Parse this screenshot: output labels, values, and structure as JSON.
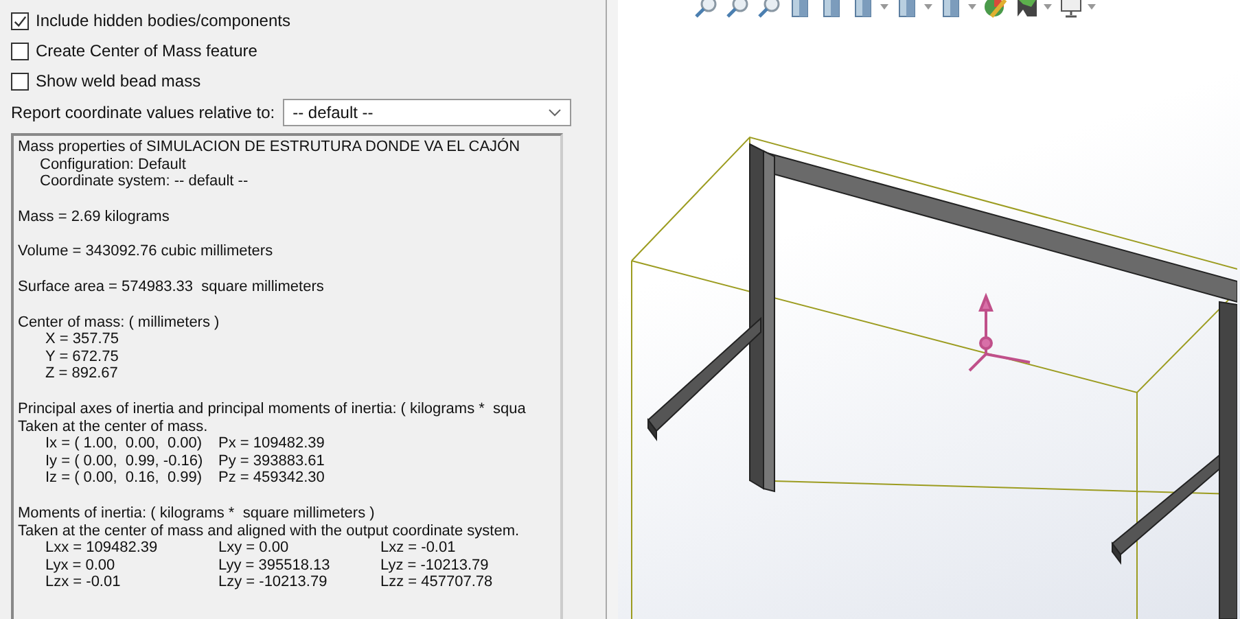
{
  "options": [
    {
      "label": "Include hidden bodies/components",
      "checked": true
    },
    {
      "label": "Create Center of Mass feature",
      "checked": false
    },
    {
      "label": "Show weld bead mass",
      "checked": false
    }
  ],
  "coordinate": {
    "label": "Report coordinate values relative to:",
    "value": "-- default --"
  },
  "results": [
    {
      "lines": [
        {
          "text": "Mass properties of SIMULACION DE ESTRUTURA DONDE VA EL CAJÓN",
          "kind": "plain"
        },
        {
          "text": "Configuration: Default",
          "kind": "indent"
        },
        {
          "text": "Coordinate system: -- default --",
          "kind": "indent"
        }
      ]
    },
    {
      "lines": [
        {
          "text": "Mass = 2.69 kilograms",
          "kind": "plain"
        }
      ]
    },
    {
      "lines": [
        {
          "text": "Volume = 343092.76 cubic millimeters",
          "kind": "plain"
        }
      ]
    },
    {
      "lines": [
        {
          "text": "Surface area = 574983.33  square millimeters",
          "kind": "plain"
        }
      ]
    },
    {
      "lines": [
        {
          "text": "Center of mass: ( millimeters )",
          "kind": "plain"
        },
        {
          "text": "X = 357.75",
          "kind": "value"
        },
        {
          "text": "Y = 672.75",
          "kind": "value"
        },
        {
          "text": "Z = 892.67",
          "kind": "value"
        }
      ]
    },
    {
      "lines": [
        {
          "text": "Principal axes of inertia and principal moments of inertia: ( kilograms *  squa",
          "kind": "plain"
        },
        {
          "text": "Taken at the center of mass.",
          "kind": "plain"
        }
      ],
      "rows": [
        [
          "Ix = ( 1.00,  0.00,  0.00)",
          "Px = 109482.39"
        ],
        [
          "Iy = ( 0.00,  0.99, -0.16)",
          "Py = 393883.61"
        ],
        [
          "Iz = ( 0.00,  0.16,  0.99)",
          "Pz = 459342.30"
        ]
      ]
    },
    {
      "lines": [
        {
          "text": "Moments of inertia: ( kilograms *  square millimeters )",
          "kind": "plain"
        },
        {
          "text": "Taken at the center of mass and aligned with the output coordinate system.",
          "kind": "plain"
        }
      ],
      "rows": [
        [
          "Lxx = 109482.39",
          "Lxy = 0.00",
          "Lxz = -0.01"
        ],
        [
          "Lyx = 0.00",
          "Lyy = 395518.13",
          "Lyz = -10213.79"
        ],
        [
          "Lzx = -0.01",
          "Lzy = -10213.79",
          "Lzz = 457707.78"
        ]
      ]
    }
  ]
}
